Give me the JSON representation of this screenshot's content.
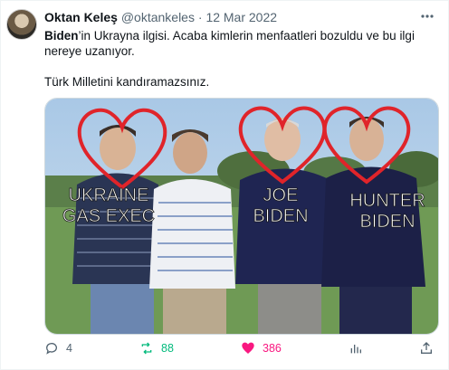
{
  "tweet": {
    "name": "Oktan Keleş",
    "handle": "@oktankeles",
    "dot": "·",
    "date": "12 Mar 2022",
    "text_bold": "Biden",
    "text_line1_rest": "’in  Ukrayna ilgisi. Acaba kimlerin menfaatleri bozuldu ve bu ilgi",
    "text_line2": "nereye uzanıyor.",
    "text_line3": "Türk Milletini kandıramazsınız."
  },
  "image": {
    "labels": [
      {
        "line1": "UKRAINE",
        "line2": "GAS EXEC"
      },
      {
        "line1": "JOE",
        "line2": "BIDEN"
      },
      {
        "line1": "HUNTER",
        "line2": "BIDEN"
      }
    ]
  },
  "actions": {
    "replies": "4",
    "reposts": "88",
    "likes": "386"
  },
  "colors": {
    "repost_green": "#00ba7c",
    "like_pink": "#f91880",
    "muted": "#536471",
    "heart_red": "#e0242a"
  }
}
